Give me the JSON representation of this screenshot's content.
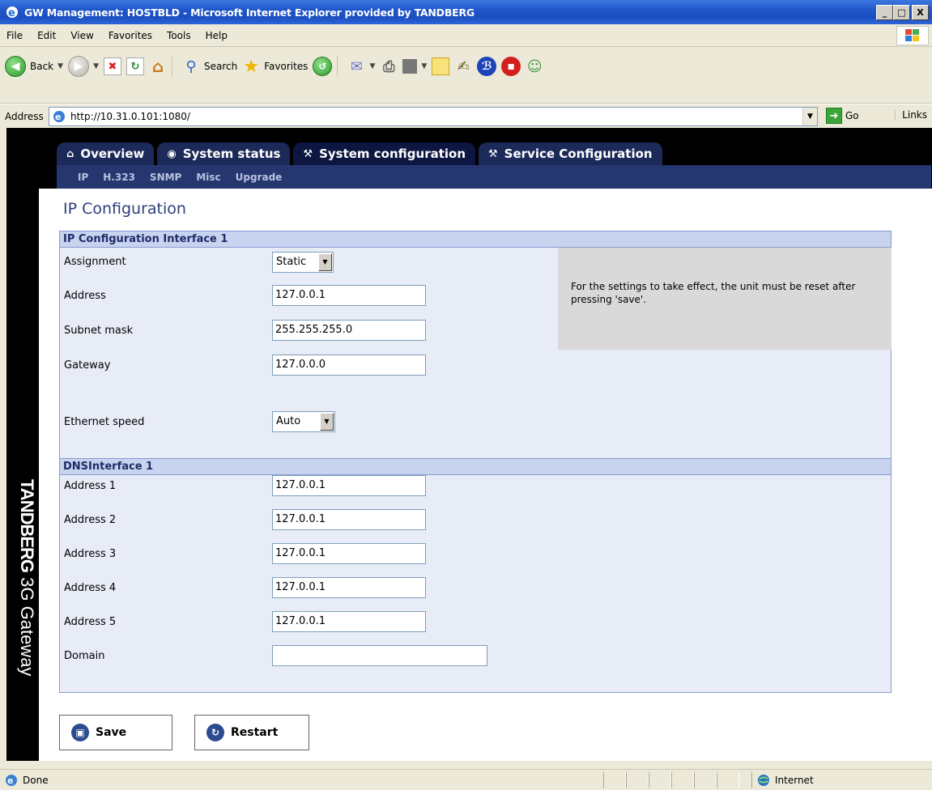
{
  "window": {
    "title": "GW Management: HOSTBLD - Microsoft Internet Explorer provided by TANDBERG",
    "min": "_",
    "max": "□",
    "close": "X"
  },
  "menu": [
    "File",
    "Edit",
    "View",
    "Favorites",
    "Tools",
    "Help"
  ],
  "toolbar": {
    "back": "Back",
    "search": "Search",
    "favorites": "Favorites"
  },
  "address": {
    "label": "Address",
    "url": "http://10.31.0.101:1080/",
    "go": "Go",
    "links": "Links"
  },
  "brand": {
    "name": "TANDBERG",
    "product": "3G Gateway"
  },
  "tabs": [
    {
      "icon": "⌂",
      "label": "Overview"
    },
    {
      "icon": "◉",
      "label": "System status"
    },
    {
      "icon": "⚒",
      "label": "System configuration"
    },
    {
      "icon": "⚒",
      "label": "Service Configuration"
    }
  ],
  "subnav": [
    "IP",
    "H.323",
    "SNMP",
    "Misc",
    "Upgrade"
  ],
  "page_title": "IP Configuration",
  "ip_section": {
    "title": "IP Configuration Interface 1",
    "assignment": {
      "label": "Assignment",
      "value": "Static"
    },
    "address": {
      "label": "Address",
      "value": "127.0.0.1"
    },
    "subnet": {
      "label": "Subnet mask",
      "value": "255.255.255.0"
    },
    "gateway": {
      "label": "Gateway",
      "value": "127.0.0.0"
    },
    "ethernet": {
      "label": "Ethernet speed",
      "value": "Auto"
    },
    "note": "For the settings to take effect, the unit must be reset after pressing 'save'."
  },
  "dns_section": {
    "title": "DNSInterface 1",
    "addresses": [
      {
        "label": "Address 1",
        "value": "127.0.0.1"
      },
      {
        "label": "Address 2",
        "value": "127.0.0.1"
      },
      {
        "label": "Address 3",
        "value": "127.0.0.1"
      },
      {
        "label": "Address 4",
        "value": "127.0.0.1"
      },
      {
        "label": "Address 5",
        "value": "127.0.0.1"
      }
    ],
    "domain": {
      "label": "Domain",
      "value": ""
    }
  },
  "buttons": {
    "save": "Save",
    "restart": "Restart"
  },
  "status": {
    "text": "Done",
    "zone": "Internet"
  }
}
